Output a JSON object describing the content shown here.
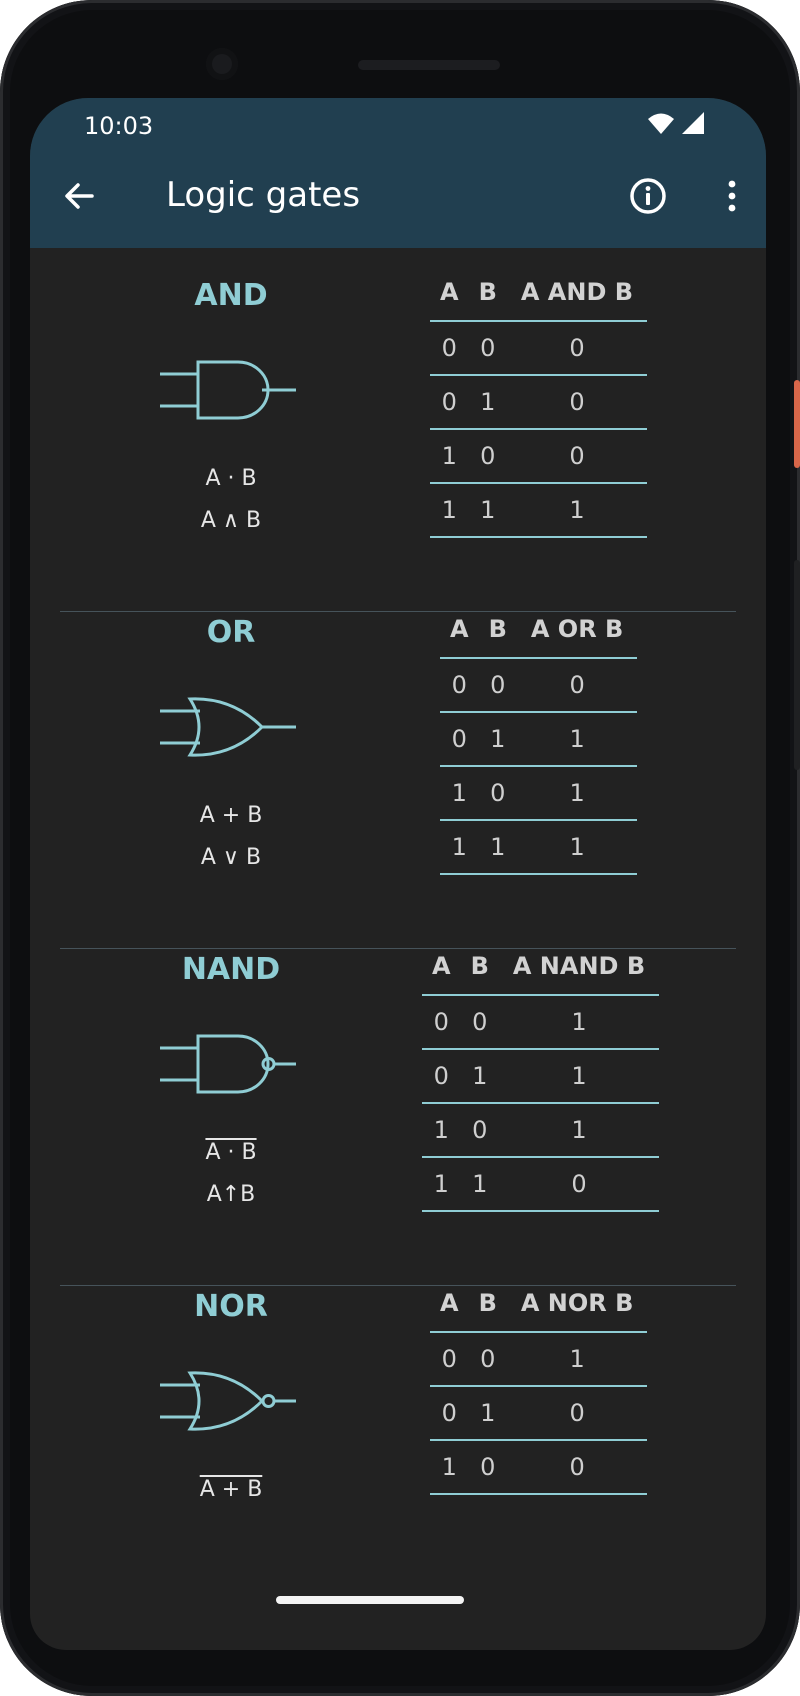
{
  "status_bar": {
    "time": "10:03"
  },
  "app_bar": {
    "title": "Logic gates"
  },
  "gates": [
    {
      "name": "AND",
      "expr1": "A · B",
      "expr2": "A ∧ B",
      "headers": [
        "A",
        "B",
        "A AND B"
      ],
      "rows": [
        [
          "0",
          "0",
          "0"
        ],
        [
          "0",
          "1",
          "0"
        ],
        [
          "1",
          "0",
          "0"
        ],
        [
          "1",
          "1",
          "1"
        ]
      ]
    },
    {
      "name": "OR",
      "expr1": "A + B",
      "expr2": "A ∨ B",
      "headers": [
        "A",
        "B",
        "A OR B"
      ],
      "rows": [
        [
          "0",
          "0",
          "0"
        ],
        [
          "0",
          "1",
          "1"
        ],
        [
          "1",
          "0",
          "1"
        ],
        [
          "1",
          "1",
          "1"
        ]
      ]
    },
    {
      "name": "NAND",
      "expr1": "A · B",
      "expr2": "A↑B",
      "headers": [
        "A",
        "B",
        "A NAND B"
      ],
      "rows": [
        [
          "0",
          "0",
          "1"
        ],
        [
          "0",
          "1",
          "1"
        ],
        [
          "1",
          "0",
          "1"
        ],
        [
          "1",
          "1",
          "0"
        ]
      ]
    },
    {
      "name": "NOR",
      "expr1": "A + B",
      "headers": [
        "A",
        "B",
        "A NOR B"
      ],
      "rows": [
        [
          "0",
          "0",
          "1"
        ],
        [
          "0",
          "1",
          "0"
        ],
        [
          "1",
          "0",
          "0"
        ]
      ]
    }
  ],
  "colors": {
    "app_bar": "#213f50",
    "background": "#222222",
    "accent": "#8fcdd4"
  }
}
